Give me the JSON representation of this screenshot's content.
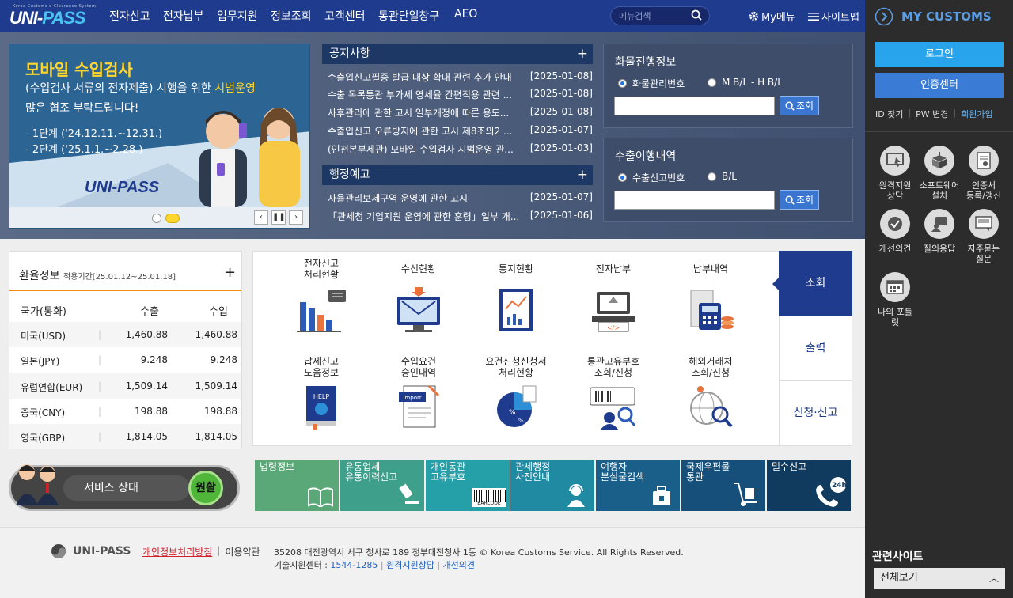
{
  "header": {
    "logo_small": "Korea Customs e-Clearance System",
    "logo_a": "UNI-",
    "logo_b": "PASS",
    "nav": [
      "전자신고",
      "전자납부",
      "업무지원",
      "정보조회",
      "고객센터",
      "통관단일창구",
      "AEO"
    ],
    "search_placeholder": "메뉴검색",
    "mymenu": "My메뉴",
    "sitemap": "사이트맵"
  },
  "banner": {
    "title": "모바일 수입검사",
    "line1a": "(수입검사 서류의 전자제출) 시행을 위한 ",
    "line1b": "시범운영",
    "line2": "많은 협조 부탁드립니다!",
    "phase1": "- 1단계 ('24.12.11.~12.31.)",
    "phase2": "- 2단계 ('25.1.1.~2.28.)",
    "logo": "UNI-PASS"
  },
  "notices": {
    "title": "공지사항",
    "items": [
      {
        "t": "수출입신고필증 발급 대상 확대 관련 추가 안내",
        "d": "[2025-01-08]"
      },
      {
        "t": "수출 목록통관 부가세 영세율 간편적용 관련 ...",
        "d": "[2025-01-08]"
      },
      {
        "t": "사후관리에 관한 고시 일부개정에 따른 용도...",
        "d": "[2025-01-08]"
      },
      {
        "t": "수출입신고 오류방지에 관한 고시 제8조의2 ...",
        "d": "[2025-01-07]"
      },
      {
        "t": "(인천본부세관) 모바일 수입검사 시범운영 관...",
        "d": "[2025-01-03]"
      }
    ]
  },
  "admin": {
    "title": "행정예고",
    "items": [
      {
        "t": "자율관리보세구역 운영에 관한 고시",
        "d": "[2025-01-07]"
      },
      {
        "t": "「관세청 기업지원 운영에 관한 훈령」일부 개...",
        "d": "[2025-01-06]"
      }
    ]
  },
  "cargo": {
    "title": "화물진행정보",
    "opt1": "화물관리번호",
    "opt2": "M B/L - H B/L",
    "btn": "조회"
  },
  "export": {
    "title": "수출이행내역",
    "opt1": "수출신고번호",
    "opt2": "B/L",
    "btn": "조회"
  },
  "exchange": {
    "title": "환율정보",
    "period": "적용기간[25.01.12~25.01.18]",
    "headers": [
      "국가(통화)",
      "수출",
      "수입"
    ],
    "rows": [
      {
        "c": "미국(USD)",
        "e": "1,460.88",
        "i": "1,460.88"
      },
      {
        "c": "일본(JPY)",
        "e": "9.248",
        "i": "9.248"
      },
      {
        "c": "유럽연합(EUR)",
        "e": "1,509.14",
        "i": "1,509.14"
      },
      {
        "c": "중국(CNY)",
        "e": "198.88",
        "i": "198.88"
      },
      {
        "c": "영국(GBP)",
        "e": "1,814.05",
        "i": "1,814.05"
      }
    ]
  },
  "services": [
    {
      "l1": "전자신고",
      "l2": "처리현황",
      "icon": "bar-chart-icon"
    },
    {
      "l1": "수신현황",
      "l2": "",
      "icon": "email-monitor-icon"
    },
    {
      "l1": "통지현황",
      "l2": "",
      "icon": "report-chart-icon"
    },
    {
      "l1": "전자납부",
      "l2": "",
      "icon": "payment-terminal-icon"
    },
    {
      "l1": "납부내역",
      "l2": "",
      "icon": "receipt-coins-icon"
    },
    {
      "l1": "납세신고",
      "l2": "도움정보",
      "icon": "help-book-icon"
    },
    {
      "l1": "수입요건",
      "l2": "승인내역",
      "icon": "import-document-icon"
    },
    {
      "l1": "요건신청신청서",
      "l2": "처리현황",
      "icon": "percent-chart-icon"
    },
    {
      "l1": "통관고유부호",
      "l2": "조회/신청",
      "icon": "barcode-search-icon"
    },
    {
      "l1": "해외거래처",
      "l2": "조회/신청",
      "icon": "globe-search-icon"
    }
  ],
  "tabs": [
    "조회",
    "출력",
    "신청·신고"
  ],
  "status": {
    "label": "서비스 상태",
    "state": "원활"
  },
  "tiles": [
    {
      "l1": "법령정보",
      "l2": "",
      "color": "#5aa878"
    },
    {
      "l1": "유통업체",
      "l2": "유통이력신고",
      "color": "#3e9f8a"
    },
    {
      "l1": "개인통관",
      "l2": "고유부호",
      "color": "#26a0a8"
    },
    {
      "l1": "관세행정",
      "l2": "사전안내",
      "color": "#1f8aa2"
    },
    {
      "l1": "여행자",
      "l2": "분실물검색",
      "color": "#1a5f8a"
    },
    {
      "l1": "국제우편물",
      "l2": "통관",
      "color": "#164f7a"
    },
    {
      "l1": "밀수신고",
      "l2": "",
      "color": "#103a5e"
    }
  ],
  "tile_extra": {
    "barcode": "BARCODE",
    "h24": "24h"
  },
  "side": {
    "title": "MY CUSTOMS",
    "login": "로그인",
    "cert": "인증센터",
    "id_find": "ID 찾기",
    "pw_change": "PW 변경",
    "join": "회원가입",
    "quick": [
      {
        "l": "원격지원\n상담",
        "icon": "remote-support-icon"
      },
      {
        "l": "소프트웨어\n설치",
        "icon": "software-install-icon"
      },
      {
        "l": "인증서\n등록/갱신",
        "icon": "certificate-icon"
      },
      {
        "l": "개선의견",
        "icon": "feedback-icon"
      },
      {
        "l": "질의응답",
        "icon": "qna-icon"
      },
      {
        "l": "자주묻는\n질문",
        "icon": "faq-icon"
      },
      {
        "l": "나의 포틀\n릿",
        "icon": "portlet-icon"
      }
    ],
    "related_title": "관련사이트",
    "related_select": "전체보기"
  },
  "footer": {
    "logo": "UNI-PASS",
    "privacy": "개인정보처리방침",
    "terms": "이용약관",
    "address": "35208 대전광역시 서구 청사로 189 정부대전청사 1동 © Korea Customs Service. All Rights Reserved.",
    "tel_label": "기술지원센터 : ",
    "tel": "1544-1285",
    "remote": "원격지원상담",
    "improve": "개선의견"
  }
}
